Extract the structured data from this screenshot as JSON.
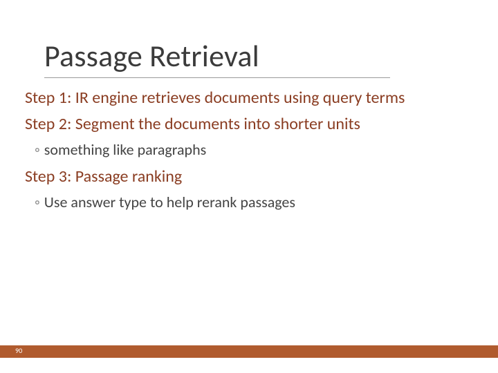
{
  "slide": {
    "title": "Passage Retrieval",
    "step1": "Step 1: IR engine retrieves documents using query terms",
    "step2": "Step 2: Segment the documents into shorter units",
    "step2_sub": "something like paragraphs",
    "step3": "Step 3: Passage ranking",
    "step3_sub": "Use answer type to help rerank passages",
    "bullet_glyph": "◦",
    "page_number": "90"
  },
  "colors": {
    "accent": "#b05b2e",
    "body_text": "#8a3d22"
  }
}
